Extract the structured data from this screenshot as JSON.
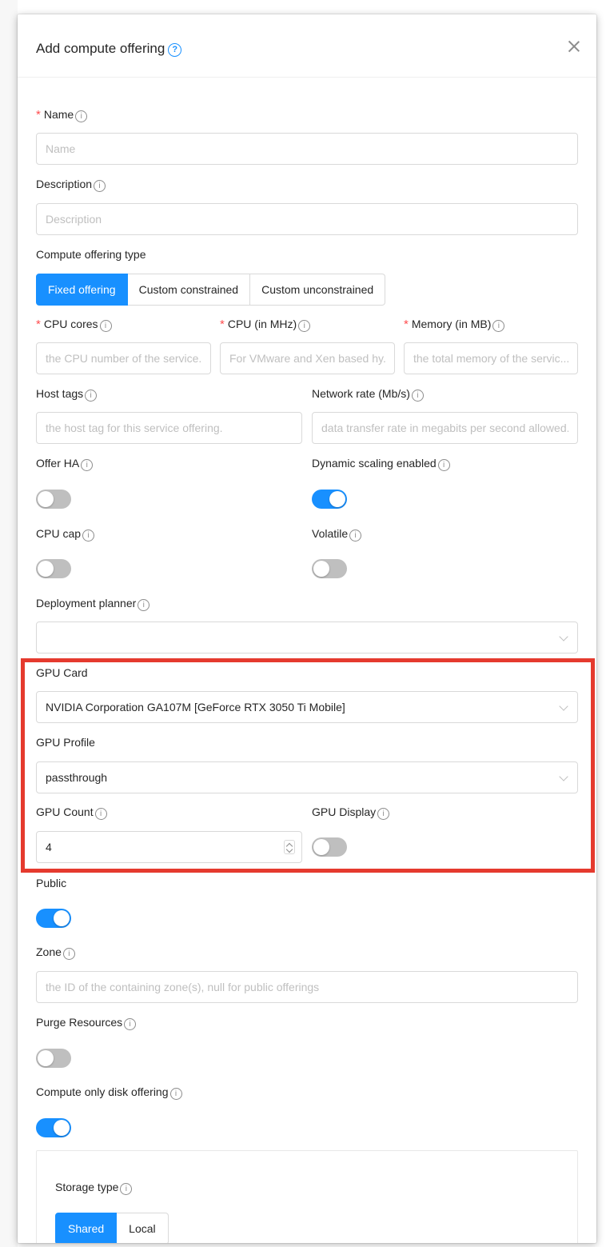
{
  "modal": {
    "title": "Add compute offering",
    "close_icon": "close-icon",
    "help_icon": "question-circle-icon"
  },
  "fields": {
    "name": {
      "label": "Name",
      "placeholder": "Name",
      "required": true
    },
    "description": {
      "label": "Description",
      "placeholder": "Description"
    },
    "offering_type": {
      "label": "Compute offering type",
      "options": [
        "Fixed offering",
        "Custom constrained",
        "Custom unconstrained"
      ],
      "selected": "Fixed offering"
    },
    "cpu_cores": {
      "label": "CPU cores",
      "placeholder": "the CPU number of the service...",
      "required": true
    },
    "cpu_mhz": {
      "label": "CPU (in MHz)",
      "placeholder": "For VMware and Xen based hy...",
      "required": true
    },
    "memory": {
      "label": "Memory (in MB)",
      "placeholder": "the total memory of the servic...",
      "required": true
    },
    "host_tags": {
      "label": "Host tags",
      "placeholder": "the host tag for this service offering."
    },
    "network_rate": {
      "label": "Network rate (Mb/s)",
      "placeholder": "data transfer rate in megabits per second allowed...."
    },
    "offer_ha": {
      "label": "Offer HA",
      "on": false
    },
    "dynamic_scaling": {
      "label": "Dynamic scaling enabled",
      "on": true
    },
    "cpu_cap": {
      "label": "CPU cap",
      "on": false
    },
    "volatile": {
      "label": "Volatile",
      "on": false
    },
    "deployment_planner": {
      "label": "Deployment planner",
      "value": ""
    },
    "gpu_card": {
      "label": "GPU Card",
      "value": "NVIDIA Corporation GA107M [GeForce RTX 3050 Ti Mobile]"
    },
    "gpu_profile": {
      "label": "GPU Profile",
      "value": "passthrough"
    },
    "gpu_count": {
      "label": "GPU Count",
      "value": "4"
    },
    "gpu_display": {
      "label": "GPU Display",
      "on": false
    },
    "public": {
      "label": "Public",
      "on": true
    },
    "zone": {
      "label": "Zone",
      "placeholder": "the ID of the containing zone(s), null for public offerings"
    },
    "purge_resources": {
      "label": "Purge Resources",
      "on": false
    },
    "compute_only_disk": {
      "label": "Compute only disk offering",
      "on": true
    },
    "storage_type": {
      "label": "Storage type",
      "options": [
        "Shared",
        "Local"
      ],
      "selected": "Shared"
    }
  },
  "colors": {
    "primary": "#1890ff",
    "required": "#ff4d4f",
    "highlight_border": "#e53a2e",
    "switch_off": "#bfbfbf"
  }
}
